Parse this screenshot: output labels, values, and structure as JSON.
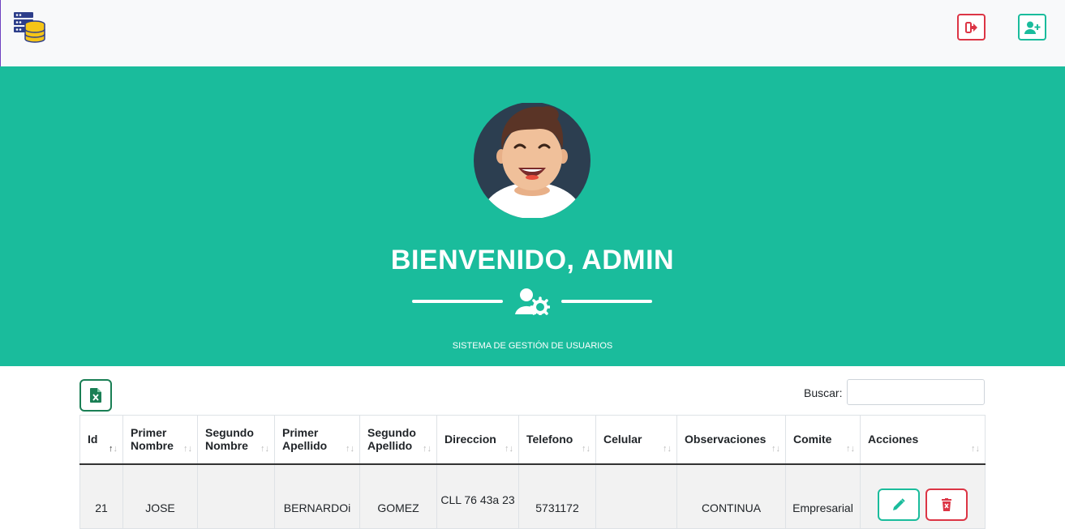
{
  "navbar": {
    "logo_icon": "database-server-icon",
    "logout_icon": "sign-out-icon",
    "add_user_icon": "user-plus-icon"
  },
  "hero": {
    "title": "BIENVENIDO, ADMIN",
    "subtitle": "SISTEMA DE GESTIÓN DE USUARIOS",
    "background_color": "#1abc9c",
    "divider_icon": "users-cog-icon"
  },
  "table": {
    "search_label": "Buscar:",
    "search_value": "",
    "columns": [
      {
        "label_line1": "Id",
        "label_line2": ""
      },
      {
        "label_line1": "Primer",
        "label_line2": "Nombre"
      },
      {
        "label_line1": "Segundo",
        "label_line2": "Nombre"
      },
      {
        "label_line1": "Primer",
        "label_line2": "Apellido"
      },
      {
        "label_line1": "Segundo",
        "label_line2": "Apellido"
      },
      {
        "label_line1": "Direccion",
        "label_line2": ""
      },
      {
        "label_line1": "Telefono",
        "label_line2": ""
      },
      {
        "label_line1": "Celular",
        "label_line2": ""
      },
      {
        "label_line1": "Observaciones",
        "label_line2": ""
      },
      {
        "label_line1": "Comite",
        "label_line2": ""
      },
      {
        "label_line1": "Acciones",
        "label_line2": ""
      }
    ],
    "rows": [
      {
        "id": "21",
        "primer_nombre": "JOSE",
        "segundo_nombre": "",
        "primer_apellido": "BERNARDOi",
        "segundo_apellido": "GOMEZ",
        "direccion": "CLL 76 43a 23",
        "telefono": "5731172",
        "celular": "",
        "observaciones": "CONTINUA",
        "comite": "Empresarial"
      }
    ],
    "excel_icon": "file-excel-icon",
    "edit_icon": "pencil-icon",
    "delete_icon": "trash-icon"
  }
}
